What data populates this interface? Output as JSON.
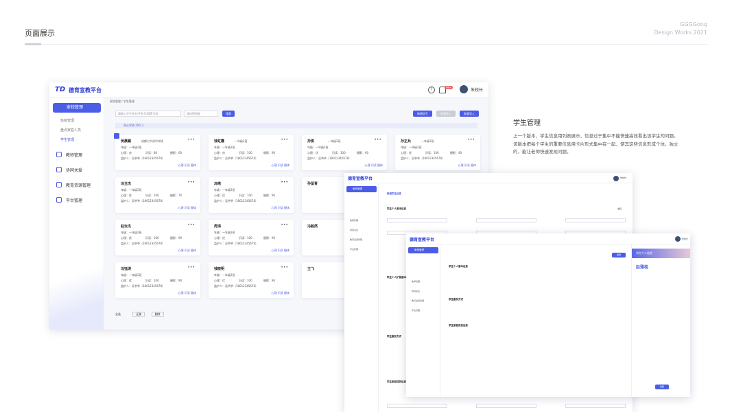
{
  "page": {
    "title": "页面展示",
    "brand_line1": "GGGGong",
    "brand_line2": "Design Works 2021"
  },
  "app": {
    "logo_mark": "TD",
    "name": "德育宣教平台",
    "user_name": "朱校长",
    "notify_badge": "99+"
  },
  "sidebar": {
    "active": "家校管理",
    "subs": [
      "班级管理",
      "盘点家庭人员",
      "学生管理"
    ],
    "items": [
      "教师管理",
      "协同关爱",
      "教育资源管理",
      "平台管理"
    ]
  },
  "toolbar": {
    "crumb": "家校管理 / 学生管理",
    "search_placeholder": "请输入学生姓名/手机号/籍贯学校",
    "select_placeholder": "请选择班级",
    "search_btn": "搜索",
    "new_btn": "新增学生",
    "import_btn": "批量导入",
    "batch_btn": "批量导入",
    "count_text": "共计学校 200 人"
  },
  "cards": [
    {
      "name": "吴晨黛",
      "grade": "成都七中初中学校",
      "class": "年级：一年级2班",
      "s1": "心理：良",
      "s2": "识读：80",
      "s3": "摄影：60",
      "guard": "监护人：吴爷爷（18012345678）",
      "links": "心理  识读  摄体"
    },
    {
      "name": "钱虹霞",
      "grade": "一年级2班",
      "class": "年级：一年级2班",
      "s1": "心理：良",
      "s2": "识读：100",
      "s3": "摄影：90",
      "guard": "监护人：吴爷爷（18012345678）",
      "links": "心理  识读  摄体"
    },
    {
      "name": "孙俊",
      "grade": "一年级2班",
      "class": "年级：一年级2班",
      "s1": "心理：优",
      "s2": "识读：100",
      "s3": "摄影：90",
      "guard": "监护人：吴爷爷（18012345678）",
      "links": "心理  识读  摄体"
    },
    {
      "name": "孙正兵",
      "grade": "一年级2班",
      "class": "年级：一年级2班",
      "s1": "心理：优",
      "s2": "识读：100",
      "s3": "摄影：40",
      "guard": "监护人：吴爷爷（18012345678）",
      "links": "心理  识读  摄体"
    },
    {
      "name": "冯玉杰",
      "grade": "",
      "class": "年级：一年级2班",
      "s1": "心理：优",
      "s2": "识读：100",
      "s3": "摄影：70",
      "guard": "监护人：吴爷爷（18012345678）",
      "links": "心理  识读  摄体"
    },
    {
      "name": "冯皓",
      "grade": "",
      "class": "年级：一年级2班",
      "s1": "心理：优",
      "s2": "识读：100",
      "s3": "摄影：90",
      "guard": "监护人：吴爷爷（18012345678）",
      "links": "心理  识读  摄体"
    },
    {
      "name": "孙留青",
      "grade": "",
      "class": "",
      "s1": "",
      "s2": "",
      "s3": "",
      "guard": "",
      "links": ""
    },
    {
      "name": "赵汝杰",
      "grade": "",
      "class": "年级：一年级2班",
      "s1": "心理：优",
      "s2": "识读：100",
      "s3": "摄影：90",
      "guard": "监护人：吴爷爷（18012345678）",
      "links": "心理  识读  摄体"
    },
    {
      "name": "周涛",
      "grade": "",
      "class": "年级：一年级2班",
      "s1": "心理：优",
      "s2": "识读：100",
      "s3": "摄影：90",
      "guard": "监护人：吴爷爷（18012345678）",
      "links": "心理  识读  摄体"
    },
    {
      "name": "冯毅然",
      "grade": "",
      "class": "",
      "s1": "",
      "s2": "",
      "s3": "",
      "guard": "",
      "links": ""
    },
    {
      "name": "冯钰涛",
      "grade": "",
      "class": "年级：一年级2班",
      "s1": "心理：优",
      "s2": "识读：100",
      "s3": "摄影：90",
      "guard": "监护人：吴爷爷（18012345678）",
      "links": "心理  识读  摄体"
    },
    {
      "name": "钱晓明",
      "grade": "",
      "class": "年级：一年级2班",
      "s1": "心理：优",
      "s2": "识读：100",
      "s3": "摄影：90",
      "guard": "监护人：吴爷爷（18012345678）",
      "links": "心理  识读  摄体"
    },
    {
      "name": "王飞",
      "grade": "",
      "class": "",
      "s1": "",
      "s2": "",
      "s3": "",
      "guard": "",
      "links": ""
    }
  ],
  "footer": {
    "select_all": "全选",
    "move": "迁移",
    "delete": "删除"
  },
  "description": {
    "title": "学生管理",
    "body": "上一个版本，学生信息用列表展示，信息过于集中不能快速高效看出该学生的问题。该版本把每个学生的重要信息用卡片形式集中在一起，使其这些信息形成个体，独立的，能让老师快速发现问题。"
  },
  "form_screen": {
    "title": "新增学生信息",
    "section1": "学生个人基本信息",
    "section2": "学生个人扩展基本信息",
    "section3": "学生服务方式",
    "section4": "学生家庭成员信息",
    "collapse": "收起"
  },
  "detail_screen": {
    "section1": "学生个人基本信息",
    "section2": "学生服务方式",
    "section3": "学生家庭成员信息",
    "panel_title": "学生个人信息",
    "student_name": "赵雅桂",
    "edit_btn": "编辑",
    "close_btn": "收起"
  }
}
